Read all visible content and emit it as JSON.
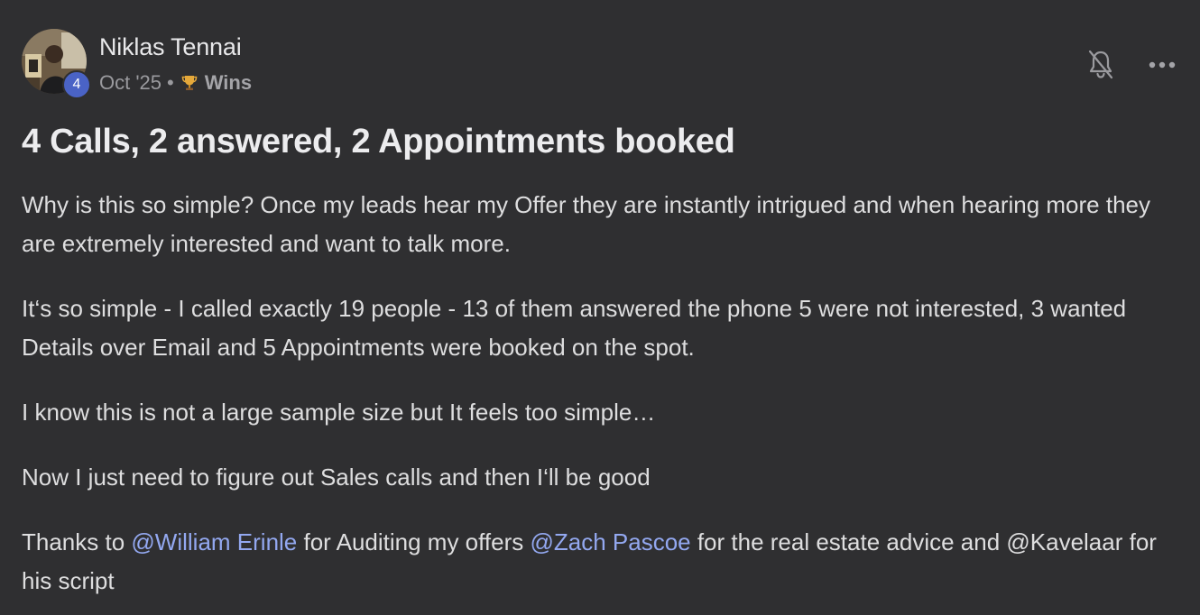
{
  "author": {
    "name": "Niklas Tennai",
    "level": "4",
    "avatar_icon": "user-avatar-photo"
  },
  "meta": {
    "date": "Oct '25",
    "separator": "•",
    "category_icon": "trophy-icon",
    "category": "Wins"
  },
  "actions": {
    "notify_icon": "bell-off-icon",
    "more_icon": "more-horizontal-icon"
  },
  "post": {
    "title": "4 Calls, 2 answered, 2 Appointments booked",
    "p1": "Why is this so simple? Once my leads hear my Offer they are instantly intrigued and when hearing more they are extremely interested and want to talk more.",
    "p2": "It‘s so simple - I called exactly 19 people - 13 of them answered the phone 5 were not interested, 3 wanted Details over Email and 5 Appointments were booked on the spot.",
    "p3": "I know this is not a large sample size but It feels too simple…",
    "p4": "Now I just need to figure out Sales calls and then I‘ll be good",
    "p5": {
      "t1": "Thanks to ",
      "mention1": "@William Erinle",
      "t2": " for Auditing my offers ",
      "mention2": "@Zach Pascoe",
      "t3": " for the real estate advice and @Kavelaar for his script"
    }
  },
  "colors": {
    "background": "#2f2f31",
    "mention": "#93a8f0",
    "level_badge": "#4a63c6"
  }
}
